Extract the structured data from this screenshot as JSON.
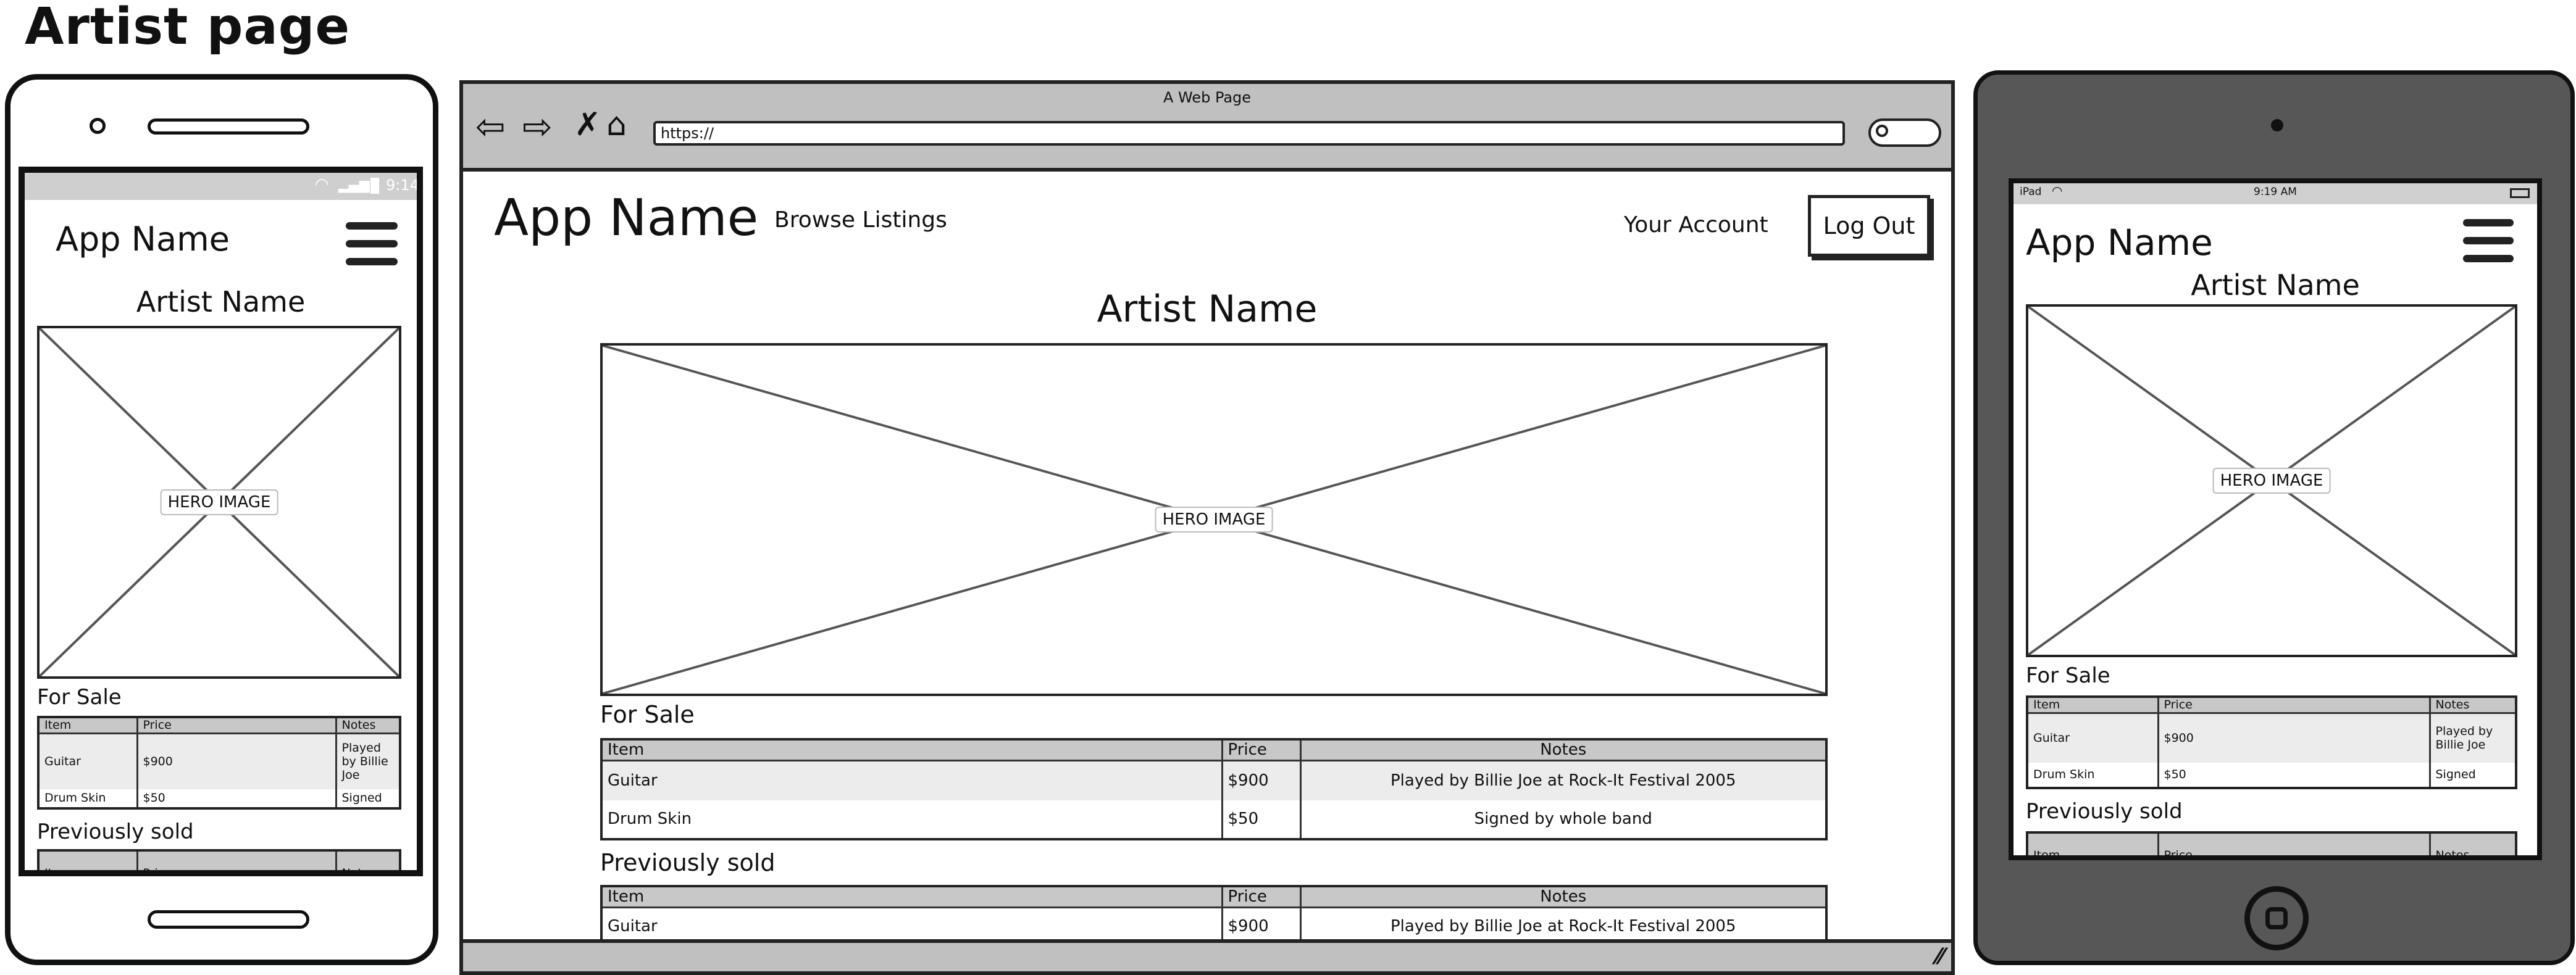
{
  "page": {
    "title": "Artist page"
  },
  "phone": {
    "status_time": "9:14",
    "app_name": "App Name",
    "artist_name": "Artist Name",
    "hero_label": "HERO IMAGE",
    "for_sale_label": "For Sale",
    "prev_sold_label": "Previously sold",
    "table_headers": [
      "Item",
      "Price",
      "Notes"
    ],
    "for_sale_rows": [
      [
        "Guitar",
        "$900",
        "Played by Billie Joe"
      ],
      [
        "Drum Skin",
        "$50",
        "Signed"
      ]
    ]
  },
  "browser": {
    "window_title": "A Web Page",
    "url": "https://",
    "app_name": "App Name",
    "nav_browse": "Browse Listings",
    "nav_account": "Your Account",
    "logout": "Log Out",
    "artist_name": "Artist Name",
    "hero_label": "HERO IMAGE",
    "for_sale_label": "For Sale",
    "prev_sold_label": "Previously sold",
    "table_headers": [
      "Item",
      "Price",
      "Notes"
    ],
    "for_sale_rows": [
      [
        "Guitar",
        "$900",
        "Played by Billie Joe at Rock-It Festival 2005"
      ],
      [
        "Drum Skin",
        "$50",
        "Signed by whole band"
      ]
    ],
    "prev_sold_rows": [
      [
        "Guitar",
        "$900",
        "Played by Billie Joe at Rock-It Festival 2005"
      ]
    ]
  },
  "tablet": {
    "status_device": "iPad",
    "status_time": "9:19 AM",
    "app_name": "App Name",
    "artist_name": "Artist Name",
    "hero_label": "HERO IMAGE",
    "for_sale_label": "For Sale",
    "prev_sold_label": "Previously sold",
    "table_headers": [
      "Item",
      "Price",
      "Notes"
    ],
    "for_sale_rows": [
      [
        "Guitar",
        "$900",
        "Played by Billie Joe"
      ],
      [
        "Drum Skin",
        "$50",
        "Signed"
      ]
    ]
  }
}
